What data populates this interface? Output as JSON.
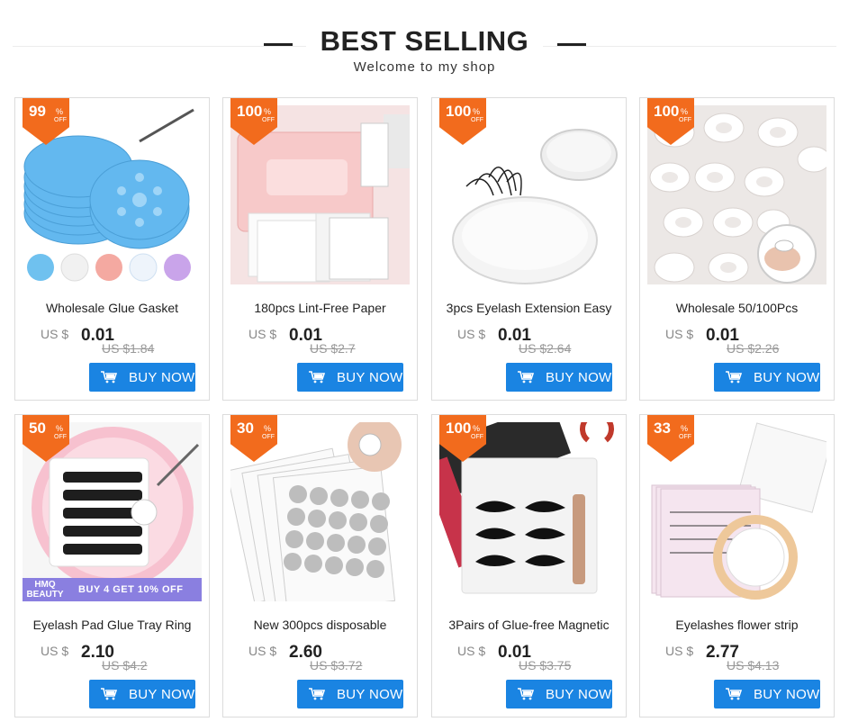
{
  "header": {
    "title": "BEST SELLING",
    "subtitle": "Welcome to my shop"
  },
  "colors": {
    "badge": "#f26b1d",
    "button": "#1a84e2"
  },
  "products": [
    {
      "discount": "99",
      "name": "Wholesale Glue Gasket",
      "currency": "US $",
      "price": "0.01",
      "original": "US $1.84",
      "button": "BUY NOW",
      "image": "blue-glue-gasket-pads"
    },
    {
      "discount": "100",
      "name": "180pcs Lint-Free Paper",
      "currency": "US $",
      "price": "0.01",
      "original": "US $2.7",
      "button": "BUY NOW",
      "image": "lint-free-wipes-box"
    },
    {
      "discount": "100",
      "name": "3pcs Eyelash Extension Easy",
      "currency": "US $",
      "price": "0.01",
      "original": "US $2.64",
      "button": "BUY NOW",
      "image": "crystal-glue-holder"
    },
    {
      "discount": "100",
      "name": "Wholesale 50/100Pcs",
      "currency": "US $",
      "price": "0.01",
      "original": "US $2.26",
      "button": "BUY NOW",
      "image": "glue-rings"
    },
    {
      "discount": "50",
      "name": "Eyelash Pad Glue Tray Ring",
      "currency": "US $",
      "price": "2.10",
      "original": "US $4.2",
      "button": "BUY NOW",
      "image": "lash-pad-tray",
      "strip_tag": "HMQ BEAUTY",
      "strip_text": "BUY 4 GET 10% OFF"
    },
    {
      "discount": "30",
      "name": "New 300pcs disposable",
      "currency": "US $",
      "price": "2.60",
      "original": "US $3.72",
      "button": "BUY NOW",
      "image": "glue-sticker-sheets"
    },
    {
      "discount": "100",
      "name": "3Pairs of Glue-free Magnetic",
      "currency": "US $",
      "price": "0.01",
      "original": "US $3.75",
      "button": "BUY NOW",
      "image": "magnetic-lashes-kit"
    },
    {
      "discount": "33",
      "name": "Eyelashes flower strip",
      "currency": "US $",
      "price": "2.77",
      "original": "US $4.13",
      "button": "BUY NOW",
      "image": "lash-strip-cards"
    }
  ]
}
